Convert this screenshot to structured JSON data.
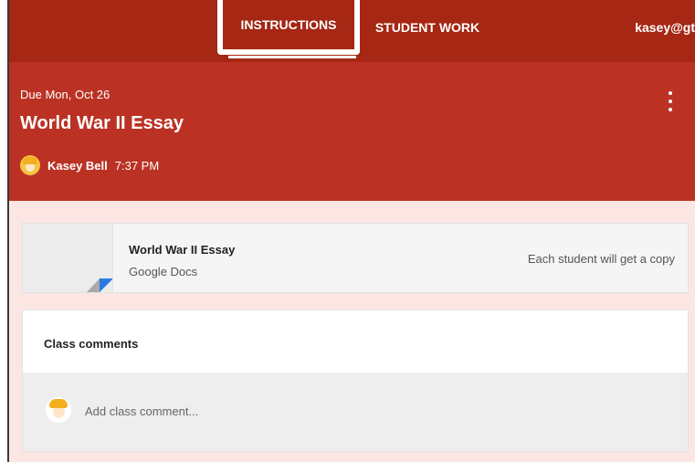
{
  "topbar": {
    "tabs": [
      {
        "label": "INSTRUCTIONS",
        "active": true
      },
      {
        "label": "STUDENT WORK",
        "active": false
      }
    ],
    "user_email": "kasey@gt"
  },
  "assignment": {
    "due": "Due Mon, Oct 26",
    "title": "World War II Essay",
    "author": "Kasey Bell",
    "time": "7:37 PM"
  },
  "attachment": {
    "title": "World War II Essay",
    "type": "Google Docs",
    "sharing": "Each student will get a copy"
  },
  "comments": {
    "title": "Class comments",
    "placeholder": "Add class comment..."
  },
  "colors": {
    "topbar": "#a52714",
    "header": "#bb3224",
    "page_bg": "#fbe6e3",
    "doc_fold": "#2a7ae4"
  },
  "icons": [
    "more-vert-icon",
    "avatar",
    "google-doc-thumbnail"
  ]
}
